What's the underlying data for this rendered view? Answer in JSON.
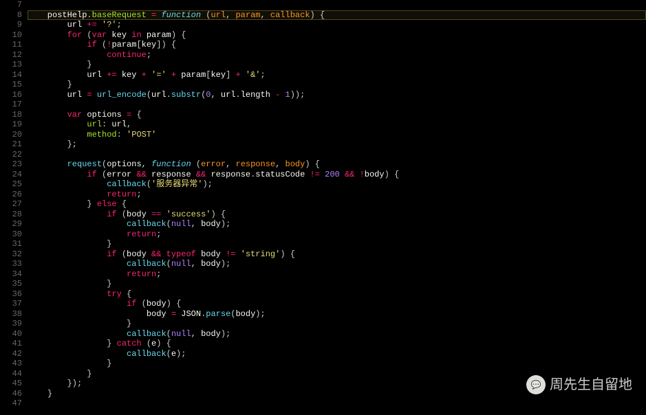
{
  "watermark": {
    "text": "周先生自留地",
    "icon": "💬"
  },
  "highlighted_line": 8,
  "lines": [
    {
      "n": 7,
      "tokens": []
    },
    {
      "n": 8,
      "tokens": [
        {
          "c": "plain",
          "t": "    postHelp"
        },
        {
          "c": "pn",
          "t": "."
        },
        {
          "c": "id",
          "t": "baseRequest"
        },
        {
          "c": "plain",
          "t": " "
        },
        {
          "c": "op",
          "t": "="
        },
        {
          "c": "plain",
          "t": " "
        },
        {
          "c": "fn",
          "t": "function"
        },
        {
          "c": "plain",
          "t": " "
        },
        {
          "c": "pn",
          "t": "("
        },
        {
          "c": "var",
          "t": "url"
        },
        {
          "c": "pn",
          "t": ", "
        },
        {
          "c": "var",
          "t": "param"
        },
        {
          "c": "pn",
          "t": ", "
        },
        {
          "c": "var",
          "t": "callback"
        },
        {
          "c": "pn",
          "t": ")"
        },
        {
          "c": "plain",
          "t": " "
        },
        {
          "c": "pn",
          "t": "{"
        }
      ]
    },
    {
      "n": 9,
      "tokens": [
        {
          "c": "plain",
          "t": "        url "
        },
        {
          "c": "op",
          "t": "+="
        },
        {
          "c": "plain",
          "t": " "
        },
        {
          "c": "str",
          "t": "'?'"
        },
        {
          "c": "pn",
          "t": ";"
        }
      ]
    },
    {
      "n": 10,
      "tokens": [
        {
          "c": "plain",
          "t": "        "
        },
        {
          "c": "kw",
          "t": "for"
        },
        {
          "c": "plain",
          "t": " "
        },
        {
          "c": "pn",
          "t": "("
        },
        {
          "c": "kw",
          "t": "var"
        },
        {
          "c": "plain",
          "t": " key "
        },
        {
          "c": "kw",
          "t": "in"
        },
        {
          "c": "plain",
          "t": " param"
        },
        {
          "c": "pn",
          "t": ")"
        },
        {
          "c": "plain",
          "t": " "
        },
        {
          "c": "pn",
          "t": "{"
        }
      ]
    },
    {
      "n": 11,
      "tokens": [
        {
          "c": "plain",
          "t": "            "
        },
        {
          "c": "kw",
          "t": "if"
        },
        {
          "c": "plain",
          "t": " "
        },
        {
          "c": "pn",
          "t": "("
        },
        {
          "c": "op",
          "t": "!"
        },
        {
          "c": "plain",
          "t": "param"
        },
        {
          "c": "pn",
          "t": "["
        },
        {
          "c": "plain",
          "t": "key"
        },
        {
          "c": "pn",
          "t": "]"
        },
        {
          "c": "pn",
          "t": ")"
        },
        {
          "c": "plain",
          "t": " "
        },
        {
          "c": "pn",
          "t": "{"
        }
      ]
    },
    {
      "n": 12,
      "tokens": [
        {
          "c": "plain",
          "t": "                "
        },
        {
          "c": "kw",
          "t": "continue"
        },
        {
          "c": "pn",
          "t": ";"
        }
      ]
    },
    {
      "n": 13,
      "tokens": [
        {
          "c": "plain",
          "t": "            "
        },
        {
          "c": "pn",
          "t": "}"
        }
      ]
    },
    {
      "n": 14,
      "tokens": [
        {
          "c": "plain",
          "t": "            url "
        },
        {
          "c": "op",
          "t": "+="
        },
        {
          "c": "plain",
          "t": " key "
        },
        {
          "c": "op",
          "t": "+"
        },
        {
          "c": "plain",
          "t": " "
        },
        {
          "c": "str",
          "t": "'='"
        },
        {
          "c": "plain",
          "t": " "
        },
        {
          "c": "op",
          "t": "+"
        },
        {
          "c": "plain",
          "t": " param"
        },
        {
          "c": "pn",
          "t": "["
        },
        {
          "c": "plain",
          "t": "key"
        },
        {
          "c": "pn",
          "t": "]"
        },
        {
          "c": "plain",
          "t": " "
        },
        {
          "c": "op",
          "t": "+"
        },
        {
          "c": "plain",
          "t": " "
        },
        {
          "c": "str",
          "t": "'&'"
        },
        {
          "c": "pn",
          "t": ";"
        }
      ]
    },
    {
      "n": 15,
      "tokens": [
        {
          "c": "plain",
          "t": "        "
        },
        {
          "c": "pn",
          "t": "}"
        }
      ]
    },
    {
      "n": 16,
      "tokens": [
        {
          "c": "plain",
          "t": "        url "
        },
        {
          "c": "op",
          "t": "="
        },
        {
          "c": "plain",
          "t": " "
        },
        {
          "c": "call",
          "t": "url_encode"
        },
        {
          "c": "pn",
          "t": "("
        },
        {
          "c": "plain",
          "t": "url"
        },
        {
          "c": "pn",
          "t": "."
        },
        {
          "c": "call",
          "t": "substr"
        },
        {
          "c": "pn",
          "t": "("
        },
        {
          "c": "num",
          "t": "0"
        },
        {
          "c": "pn",
          "t": ", "
        },
        {
          "c": "plain",
          "t": "url"
        },
        {
          "c": "pn",
          "t": "."
        },
        {
          "c": "plain",
          "t": "length "
        },
        {
          "c": "op",
          "t": "-"
        },
        {
          "c": "plain",
          "t": " "
        },
        {
          "c": "num",
          "t": "1"
        },
        {
          "c": "pn",
          "t": "));"
        }
      ]
    },
    {
      "n": 17,
      "tokens": []
    },
    {
      "n": 18,
      "tokens": [
        {
          "c": "plain",
          "t": "        "
        },
        {
          "c": "kw",
          "t": "var"
        },
        {
          "c": "plain",
          "t": " options "
        },
        {
          "c": "op",
          "t": "="
        },
        {
          "c": "plain",
          "t": " "
        },
        {
          "c": "pn",
          "t": "{"
        }
      ]
    },
    {
      "n": 19,
      "tokens": [
        {
          "c": "plain",
          "t": "            "
        },
        {
          "c": "id",
          "t": "url"
        },
        {
          "c": "pn",
          "t": ":"
        },
        {
          "c": "plain",
          "t": " url"
        },
        {
          "c": "pn",
          "t": ","
        }
      ]
    },
    {
      "n": 20,
      "tokens": [
        {
          "c": "plain",
          "t": "            "
        },
        {
          "c": "id",
          "t": "method"
        },
        {
          "c": "pn",
          "t": ":"
        },
        {
          "c": "plain",
          "t": " "
        },
        {
          "c": "str",
          "t": "'POST'"
        }
      ]
    },
    {
      "n": 21,
      "tokens": [
        {
          "c": "plain",
          "t": "        "
        },
        {
          "c": "pn",
          "t": "};"
        }
      ]
    },
    {
      "n": 22,
      "tokens": []
    },
    {
      "n": 23,
      "tokens": [
        {
          "c": "plain",
          "t": "        "
        },
        {
          "c": "call",
          "t": "request"
        },
        {
          "c": "pn",
          "t": "("
        },
        {
          "c": "plain",
          "t": "options"
        },
        {
          "c": "pn",
          "t": ", "
        },
        {
          "c": "fn",
          "t": "function"
        },
        {
          "c": "plain",
          "t": " "
        },
        {
          "c": "pn",
          "t": "("
        },
        {
          "c": "var",
          "t": "error"
        },
        {
          "c": "pn",
          "t": ", "
        },
        {
          "c": "var",
          "t": "response"
        },
        {
          "c": "pn",
          "t": ", "
        },
        {
          "c": "var",
          "t": "body"
        },
        {
          "c": "pn",
          "t": ")"
        },
        {
          "c": "plain",
          "t": " "
        },
        {
          "c": "pn",
          "t": "{"
        }
      ]
    },
    {
      "n": 24,
      "tokens": [
        {
          "c": "plain",
          "t": "            "
        },
        {
          "c": "kw",
          "t": "if"
        },
        {
          "c": "plain",
          "t": " "
        },
        {
          "c": "pn",
          "t": "("
        },
        {
          "c": "plain",
          "t": "error "
        },
        {
          "c": "op",
          "t": "&&"
        },
        {
          "c": "plain",
          "t": " response "
        },
        {
          "c": "op",
          "t": "&&"
        },
        {
          "c": "plain",
          "t": " response"
        },
        {
          "c": "pn",
          "t": "."
        },
        {
          "c": "plain",
          "t": "statusCode "
        },
        {
          "c": "op",
          "t": "!="
        },
        {
          "c": "plain",
          "t": " "
        },
        {
          "c": "num",
          "t": "200"
        },
        {
          "c": "plain",
          "t": " "
        },
        {
          "c": "op",
          "t": "&&"
        },
        {
          "c": "plain",
          "t": " "
        },
        {
          "c": "op",
          "t": "!"
        },
        {
          "c": "plain",
          "t": "body"
        },
        {
          "c": "pn",
          "t": ")"
        },
        {
          "c": "plain",
          "t": " "
        },
        {
          "c": "pn",
          "t": "{"
        }
      ]
    },
    {
      "n": 25,
      "tokens": [
        {
          "c": "plain",
          "t": "                "
        },
        {
          "c": "call",
          "t": "callback"
        },
        {
          "c": "pn",
          "t": "("
        },
        {
          "c": "str",
          "t": "'服务器异常'"
        },
        {
          "c": "pn",
          "t": ");"
        }
      ]
    },
    {
      "n": 26,
      "tokens": [
        {
          "c": "plain",
          "t": "                "
        },
        {
          "c": "kw",
          "t": "return"
        },
        {
          "c": "pn",
          "t": ";"
        }
      ]
    },
    {
      "n": 27,
      "tokens": [
        {
          "c": "plain",
          "t": "            "
        },
        {
          "c": "pn",
          "t": "}"
        },
        {
          "c": "plain",
          "t": " "
        },
        {
          "c": "kw",
          "t": "else"
        },
        {
          "c": "plain",
          "t": " "
        },
        {
          "c": "pn",
          "t": "{"
        }
      ]
    },
    {
      "n": 28,
      "tokens": [
        {
          "c": "plain",
          "t": "                "
        },
        {
          "c": "kw",
          "t": "if"
        },
        {
          "c": "plain",
          "t": " "
        },
        {
          "c": "pn",
          "t": "("
        },
        {
          "c": "plain",
          "t": "body "
        },
        {
          "c": "op",
          "t": "=="
        },
        {
          "c": "plain",
          "t": " "
        },
        {
          "c": "str",
          "t": "'success'"
        },
        {
          "c": "pn",
          "t": ")"
        },
        {
          "c": "plain",
          "t": " "
        },
        {
          "c": "pn",
          "t": "{"
        }
      ]
    },
    {
      "n": 29,
      "tokens": [
        {
          "c": "plain",
          "t": "                    "
        },
        {
          "c": "call",
          "t": "callback"
        },
        {
          "c": "pn",
          "t": "("
        },
        {
          "c": "num",
          "t": "null"
        },
        {
          "c": "pn",
          "t": ", "
        },
        {
          "c": "plain",
          "t": "body"
        },
        {
          "c": "pn",
          "t": ");"
        }
      ]
    },
    {
      "n": 30,
      "tokens": [
        {
          "c": "plain",
          "t": "                    "
        },
        {
          "c": "kw",
          "t": "return"
        },
        {
          "c": "pn",
          "t": ";"
        }
      ]
    },
    {
      "n": 31,
      "tokens": [
        {
          "c": "plain",
          "t": "                "
        },
        {
          "c": "pn",
          "t": "}"
        }
      ]
    },
    {
      "n": 32,
      "tokens": [
        {
          "c": "plain",
          "t": "                "
        },
        {
          "c": "kw",
          "t": "if"
        },
        {
          "c": "plain",
          "t": " "
        },
        {
          "c": "pn",
          "t": "("
        },
        {
          "c": "plain",
          "t": "body "
        },
        {
          "c": "op",
          "t": "&&"
        },
        {
          "c": "plain",
          "t": " "
        },
        {
          "c": "kw",
          "t": "typeof"
        },
        {
          "c": "plain",
          "t": " body "
        },
        {
          "c": "op",
          "t": "!="
        },
        {
          "c": "plain",
          "t": " "
        },
        {
          "c": "str",
          "t": "'string'"
        },
        {
          "c": "pn",
          "t": ")"
        },
        {
          "c": "plain",
          "t": " "
        },
        {
          "c": "pn",
          "t": "{"
        }
      ]
    },
    {
      "n": 33,
      "tokens": [
        {
          "c": "plain",
          "t": "                    "
        },
        {
          "c": "call",
          "t": "callback"
        },
        {
          "c": "pn",
          "t": "("
        },
        {
          "c": "num",
          "t": "null"
        },
        {
          "c": "pn",
          "t": ", "
        },
        {
          "c": "plain",
          "t": "body"
        },
        {
          "c": "pn",
          "t": ");"
        }
      ]
    },
    {
      "n": 34,
      "tokens": [
        {
          "c": "plain",
          "t": "                    "
        },
        {
          "c": "kw",
          "t": "return"
        },
        {
          "c": "pn",
          "t": ";"
        }
      ]
    },
    {
      "n": 35,
      "tokens": [
        {
          "c": "plain",
          "t": "                "
        },
        {
          "c": "pn",
          "t": "}"
        }
      ]
    },
    {
      "n": 36,
      "tokens": [
        {
          "c": "plain",
          "t": "                "
        },
        {
          "c": "kw",
          "t": "try"
        },
        {
          "c": "plain",
          "t": " "
        },
        {
          "c": "pn",
          "t": "{"
        }
      ]
    },
    {
      "n": 37,
      "tokens": [
        {
          "c": "plain",
          "t": "                    "
        },
        {
          "c": "kw",
          "t": "if"
        },
        {
          "c": "plain",
          "t": " "
        },
        {
          "c": "pn",
          "t": "("
        },
        {
          "c": "plain",
          "t": "body"
        },
        {
          "c": "pn",
          "t": ")"
        },
        {
          "c": "plain",
          "t": " "
        },
        {
          "c": "pn",
          "t": "{"
        }
      ]
    },
    {
      "n": 38,
      "tokens": [
        {
          "c": "plain",
          "t": "                        body "
        },
        {
          "c": "op",
          "t": "="
        },
        {
          "c": "plain",
          "t": " JSON"
        },
        {
          "c": "pn",
          "t": "."
        },
        {
          "c": "call",
          "t": "parse"
        },
        {
          "c": "pn",
          "t": "("
        },
        {
          "c": "plain",
          "t": "body"
        },
        {
          "c": "pn",
          "t": ");"
        }
      ]
    },
    {
      "n": 39,
      "tokens": [
        {
          "c": "plain",
          "t": "                    "
        },
        {
          "c": "pn",
          "t": "}"
        }
      ]
    },
    {
      "n": 40,
      "tokens": [
        {
          "c": "plain",
          "t": "                    "
        },
        {
          "c": "call",
          "t": "callback"
        },
        {
          "c": "pn",
          "t": "("
        },
        {
          "c": "num",
          "t": "null"
        },
        {
          "c": "pn",
          "t": ", "
        },
        {
          "c": "plain",
          "t": "body"
        },
        {
          "c": "pn",
          "t": ");"
        }
      ]
    },
    {
      "n": 41,
      "tokens": [
        {
          "c": "plain",
          "t": "                "
        },
        {
          "c": "pn",
          "t": "}"
        },
        {
          "c": "plain",
          "t": " "
        },
        {
          "c": "kw",
          "t": "catch"
        },
        {
          "c": "plain",
          "t": " "
        },
        {
          "c": "pn",
          "t": "("
        },
        {
          "c": "plain",
          "t": "e"
        },
        {
          "c": "pn",
          "t": ")"
        },
        {
          "c": "plain",
          "t": " "
        },
        {
          "c": "pn",
          "t": "{"
        }
      ]
    },
    {
      "n": 42,
      "tokens": [
        {
          "c": "plain",
          "t": "                    "
        },
        {
          "c": "call",
          "t": "callback"
        },
        {
          "c": "pn",
          "t": "("
        },
        {
          "c": "plain",
          "t": "e"
        },
        {
          "c": "pn",
          "t": ");"
        }
      ]
    },
    {
      "n": 43,
      "tokens": [
        {
          "c": "plain",
          "t": "                "
        },
        {
          "c": "pn",
          "t": "}"
        }
      ]
    },
    {
      "n": 44,
      "tokens": [
        {
          "c": "plain",
          "t": "            "
        },
        {
          "c": "pn",
          "t": "}"
        }
      ]
    },
    {
      "n": 45,
      "tokens": [
        {
          "c": "plain",
          "t": "        "
        },
        {
          "c": "pn",
          "t": "});"
        }
      ]
    },
    {
      "n": 46,
      "tokens": [
        {
          "c": "plain",
          "t": "    "
        },
        {
          "c": "pn",
          "t": "}"
        }
      ]
    },
    {
      "n": 47,
      "tokens": []
    }
  ]
}
